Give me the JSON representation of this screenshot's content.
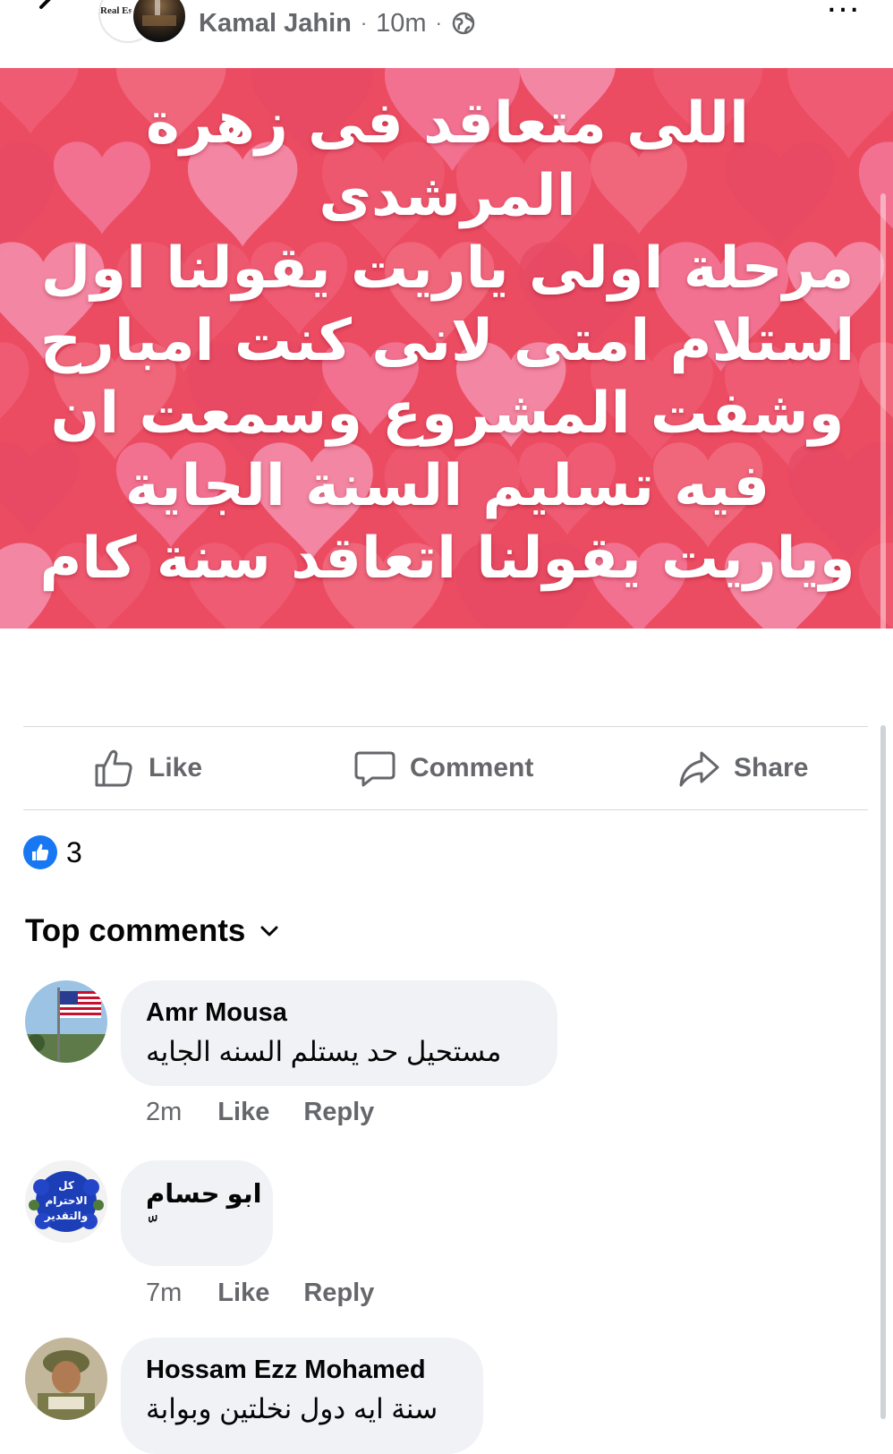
{
  "post": {
    "author": "Kamal Jahin",
    "time": "10m",
    "separator": "·",
    "privacy_icon": "globe-icon",
    "page_logo_text": "Real Est",
    "text_lines": [
      "اللى متعاقد فى زهرة المرشدى",
      "مرحلة اولى ياريت يقولنا اول",
      "استلام امتى لانى كنت امبارح",
      "وشفت المشروع وسمعت ان",
      "فيه تسليم السنة الجاية",
      "وياريت يقولنا اتعاقد سنة كام"
    ],
    "background_color": "#ec4c62",
    "more_icon": "…"
  },
  "actions": {
    "like": "Like",
    "comment": "Comment",
    "share": "Share"
  },
  "reactions": {
    "count": "3",
    "icon": "like-reaction-icon",
    "color": "#1877f2"
  },
  "comments_header": "Top comments",
  "comments": [
    {
      "name": "Amr Mousa",
      "text": "مستحيل حد يستلم السنه الجايه",
      "time": "2m",
      "like": "Like",
      "reply": "Reply"
    },
    {
      "name": "ابو حسام",
      "text": "ّ",
      "time": "7m",
      "like": "Like",
      "reply": "Reply",
      "avatar_text": "كل الاحترام والتقدير"
    },
    {
      "name": "Hossam Ezz Mohamed",
      "text": "سنة ايه دول نخلتين وبوابة"
    }
  ]
}
